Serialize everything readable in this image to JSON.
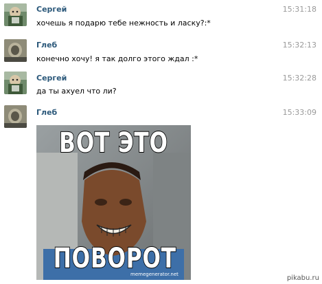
{
  "colors": {
    "name": "#2b587a",
    "time": "#999999",
    "text": "#000000"
  },
  "messages": [
    {
      "author": "Сергей",
      "time": "15:31:18",
      "text": "хочешь я подарю тебе нежность и ласку?:*",
      "avatar": "sergey-avatar"
    },
    {
      "author": "Глеб",
      "time": "15:32:13",
      "text": "конечно хочу! я так долго этого ждал :*",
      "avatar": "gleb-avatar"
    },
    {
      "author": "Сергей",
      "time": "15:32:28",
      "text": "да ты ахуел что ли?",
      "avatar": "sergey-avatar"
    },
    {
      "author": "Глеб",
      "time": "15:33:09",
      "text": "",
      "avatar": "gleb-avatar"
    }
  ],
  "meme": {
    "top_text": "ВОТ ЭТО",
    "bottom_text": "ПОВОРОТ",
    "credit": "memegenerator.net"
  },
  "watermark": "pikabu.ru"
}
